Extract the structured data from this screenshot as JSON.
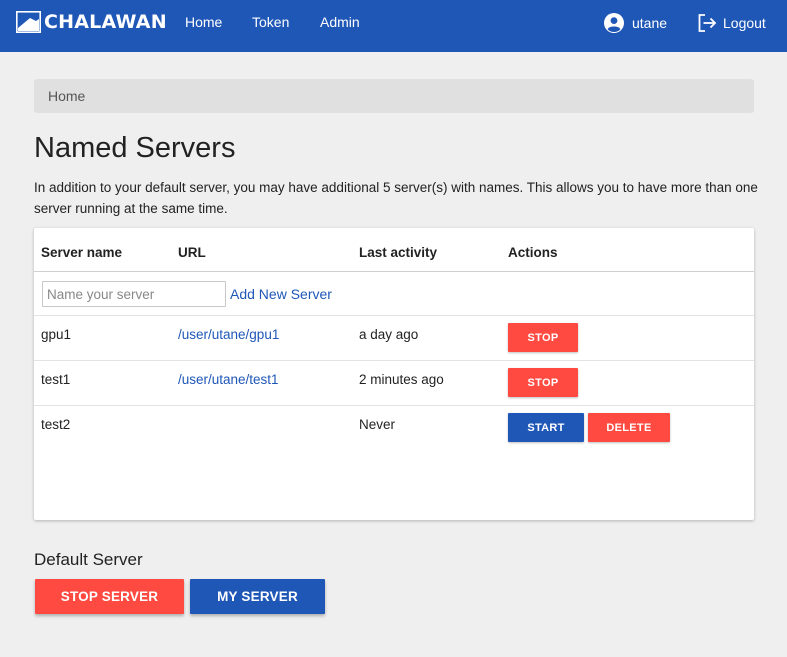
{
  "brand": {
    "name": "CHALAWAN",
    "logo_icon": "chalawan-logo-icon"
  },
  "nav": {
    "links": [
      {
        "label": "Home"
      },
      {
        "label": "Token"
      },
      {
        "label": "Admin"
      }
    ],
    "user": {
      "label": "utane",
      "icon": "user-circle-icon"
    },
    "logout": {
      "label": "Logout",
      "icon": "logout-icon"
    }
  },
  "breadcrumb": {
    "label": "Home"
  },
  "page": {
    "title": "Named Servers",
    "description": "In addition to your default server, you may have additional 5 server(s) with names. This allows you to have more than one server running at the same time."
  },
  "table": {
    "headers": [
      "Server name",
      "URL",
      "Last activity",
      "Actions"
    ],
    "new_server": {
      "placeholder": "Name your server",
      "value": "",
      "add_label": "Add New Server"
    },
    "rows": [
      {
        "name": "gpu1",
        "url": "/user/utane/gpu1",
        "last_activity": "a day ago",
        "actions": [
          "STOP"
        ]
      },
      {
        "name": "test1",
        "url": "/user/utane/test1",
        "last_activity": "2 minutes ago",
        "actions": [
          "STOP"
        ]
      },
      {
        "name": "test2",
        "url": "",
        "last_activity": "Never",
        "actions": [
          "START",
          "DELETE"
        ]
      }
    ]
  },
  "default_server": {
    "title": "Default Server",
    "stop_label": "STOP SERVER",
    "my_server_label": "MY SERVER"
  },
  "colors": {
    "navbar": "#1f57b7",
    "primary": "#1f57b7",
    "danger": "#ff4a41",
    "background": "#efefef"
  }
}
